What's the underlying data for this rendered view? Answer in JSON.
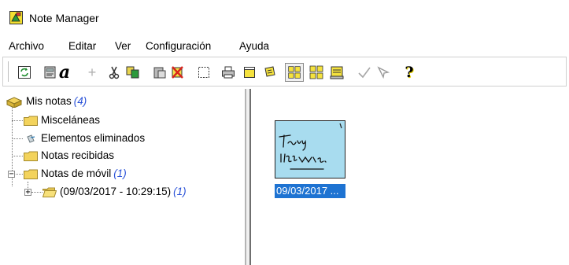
{
  "window": {
    "title": "Note Manager"
  },
  "menu": [
    "Archivo",
    "Editar",
    "Ver",
    "Configuración",
    "Ayuda"
  ],
  "toolbar": {
    "buttons": [
      "refresh-icon",
      "book-icon",
      "font-icon",
      "add-icon",
      "cut-icon",
      "copy-icon",
      "paste-icon",
      "delete-icon",
      "select-icon",
      "print-icon",
      "new-note-icon",
      "edit-note-icon",
      "large-icons-view-icon",
      "small-icons-view-icon",
      "details-view-icon",
      "check-icon",
      "pointer-icon",
      "help-icon"
    ],
    "font_glyph": "a",
    "help_glyph": "?",
    "add_glyph": "+"
  },
  "tree": {
    "root": {
      "label": "Mis notas",
      "count": "(4)"
    },
    "items": [
      {
        "label": "Misceláneas"
      },
      {
        "label": "Elementos eliminados"
      },
      {
        "label": "Notas recibidas"
      },
      {
        "label": "Notas de móvil",
        "count": "(1)",
        "expander": "−"
      },
      {
        "label": "(09/03/2017 - 10:29:15)",
        "count": "(1)",
        "expander": "+"
      }
    ]
  },
  "content": {
    "notes": [
      {
        "caption": "09/03/2017 ..."
      }
    ]
  },
  "colors": {
    "note_bg": "#a8dcef",
    "selection": "#1e73d2",
    "folder": "#f3d35c",
    "count_text": "#2a52d8"
  }
}
